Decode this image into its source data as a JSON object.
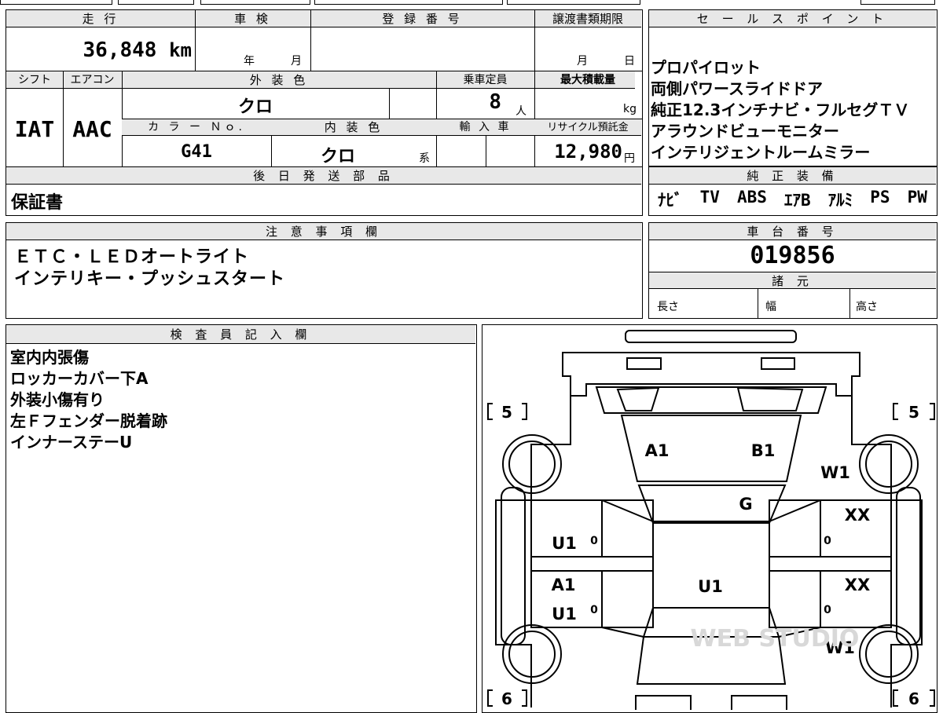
{
  "sheet": {
    "mileage": {
      "header": "走 行",
      "value": "36,848",
      "unit": "km"
    },
    "inspection": {
      "header": "車 検",
      "year_label": "年",
      "month_label": "月"
    },
    "registration": {
      "header": "登 録 番 号",
      "value": ""
    },
    "transfer_deadline": {
      "header": "譲渡書類期限",
      "month_label": "月",
      "day_label": "日"
    },
    "shift": {
      "header": "シフト",
      "value": "IAT"
    },
    "aircon": {
      "header": "エアコン",
      "value": "AAC"
    },
    "exterior_color": {
      "header": "外 装 色",
      "value": "クロ"
    },
    "capacity": {
      "header": "乗車定員",
      "value": "8",
      "unit": "人"
    },
    "max_load": {
      "header": "最大積載量",
      "unit": "kg"
    },
    "color_no": {
      "header": "カ ラ ー Ｎｏ.",
      "value": "G41"
    },
    "interior_color": {
      "header": "内 装 色",
      "value": "クロ",
      "suffix": "系"
    },
    "import": {
      "header": "輸 入 車"
    },
    "recycle": {
      "header": "リサイクル預託金",
      "value": "12,980",
      "unit": "円"
    },
    "later_parts": {
      "header": "後 日 発 送 部 品",
      "value": "保証書"
    }
  },
  "sales_points": {
    "header": "セ ー ル ス ポ イ ン ト",
    "items": [
      "プロパイロット",
      "両側パワースライドドア",
      "純正12.3インチナビ・フルセグＴＶ",
      "アラウンドビューモニター",
      "インテリジェントルームミラー"
    ]
  },
  "equipment": {
    "header": "純 正 装 備",
    "items": [
      "ﾅﾋﾞ",
      "TV",
      "ABS",
      "ｴｱB",
      "ｱﾙﾐ",
      "PS",
      "PW"
    ]
  },
  "notes": {
    "header": "注 意 事 項 欄",
    "lines": [
      "ＥＴＣ・ＬＥＤオートライト",
      "インテリキー・プッシュスタート"
    ]
  },
  "chassis": {
    "header": "車 台 番 号",
    "value": "019856",
    "specs_header": "諸 元",
    "length_label": "長さ",
    "width_label": "幅",
    "height_label": "高さ"
  },
  "inspector": {
    "header": "検 査 員 記 入 欄",
    "lines": [
      "室内内張傷",
      "ロッカーカバー下A",
      "外装小傷有り",
      "左Ｆフェンダー脱着跡",
      "インナーステーU"
    ]
  },
  "diagram": {
    "tire_tl": "5",
    "tire_tr": "5",
    "tire_bl": "6",
    "tire_br": "6",
    "marks": {
      "hood_left": "A1",
      "hood_right": "B1",
      "windshield": "G",
      "front_right_wheel": "W1",
      "front_right_door": "XX",
      "rear_right_door": "XX",
      "rear_right_wheel": "W1",
      "roof": "U1",
      "left_front_door": "U1",
      "left_rear_door_1": "A1",
      "left_rear_door_2": "U1",
      "side_zero": "0"
    },
    "watermark": "WEB STUDIO"
  }
}
